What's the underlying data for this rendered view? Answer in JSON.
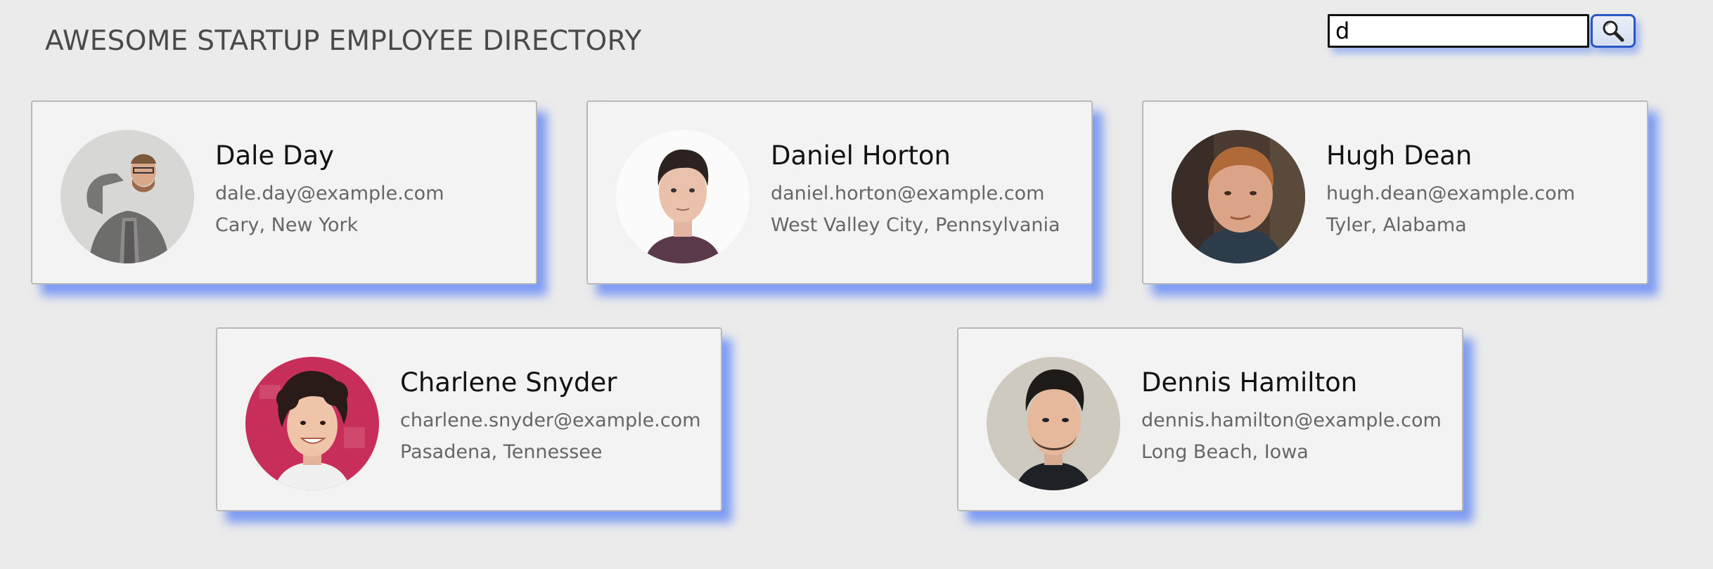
{
  "header": {
    "title": "AWESOME STARTUP EMPLOYEE DIRECTORY"
  },
  "search": {
    "value": "d",
    "button_icon": "magnifier-icon"
  },
  "employees": [
    {
      "name": "Dale Day",
      "email": "dale.day@example.com",
      "location": "Cary, New York"
    },
    {
      "name": "Daniel Horton",
      "email": "daniel.horton@example.com",
      "location": "West Valley City, Pennsylvania"
    },
    {
      "name": "Hugh Dean",
      "email": "hugh.dean@example.com",
      "location": "Tyler, Alabama"
    },
    {
      "name": "Charlene Snyder",
      "email": "charlene.snyder@example.com",
      "location": "Pasadena, Tennessee"
    },
    {
      "name": "Dennis Hamilton",
      "email": "dennis.hamilton@example.com",
      "location": "Long Beach, Iowa"
    }
  ],
  "colors": {
    "shadow": "#5a82f5",
    "card_bg": "#f3f3f3",
    "page_bg": "#ebebeb",
    "button_border": "#2a56c6"
  }
}
